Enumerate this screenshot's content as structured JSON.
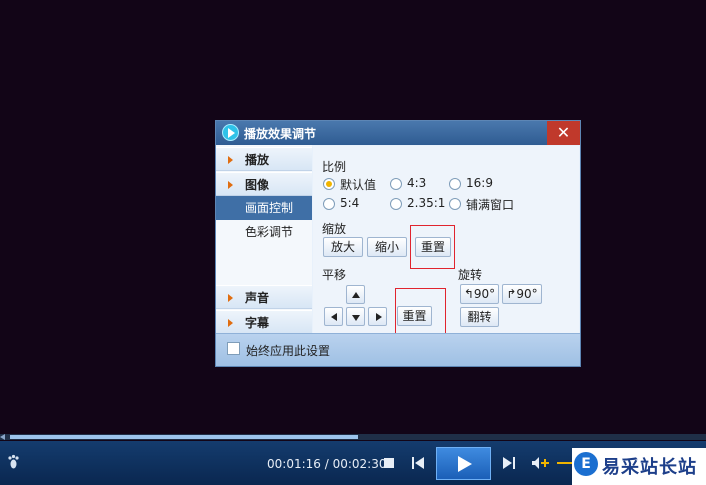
{
  "dialog": {
    "title": "播放效果调节",
    "close_glyph": "✕",
    "sidebar": {
      "groups": [
        {
          "label": "播放"
        },
        {
          "label": "图像"
        },
        {
          "label": "声音"
        },
        {
          "label": "字幕"
        }
      ],
      "subitems": [
        {
          "label": "画面控制",
          "active": true
        },
        {
          "label": "色彩调节",
          "active": false
        }
      ]
    },
    "ratio": {
      "title": "比例",
      "options": [
        {
          "label": "默认值",
          "selected": true
        },
        {
          "label": "4:3",
          "selected": false
        },
        {
          "label": "16:9",
          "selected": false
        },
        {
          "label": "5:4",
          "selected": false
        },
        {
          "label": "2.35:1",
          "selected": false
        },
        {
          "label": "铺满窗口",
          "selected": false
        }
      ]
    },
    "zoom": {
      "title": "缩放",
      "zoom_in": "放大",
      "zoom_out": "缩小",
      "reset": "重置"
    },
    "pan": {
      "title": "平移",
      "reset": "重置"
    },
    "rotate": {
      "title": "旋转",
      "rotate_left": "↰90°",
      "rotate_right": "↱90°",
      "flip": "翻转"
    },
    "footer": {
      "always_apply": "始终应用此设置",
      "checked": false
    }
  },
  "player": {
    "time": "00:01:16 / 00:02:30",
    "progress_fraction": 0.507,
    "colors": {
      "accent": "#1b5fb7",
      "bar": "#0a2750"
    }
  },
  "watermark": {
    "text": "易采站长站"
  }
}
